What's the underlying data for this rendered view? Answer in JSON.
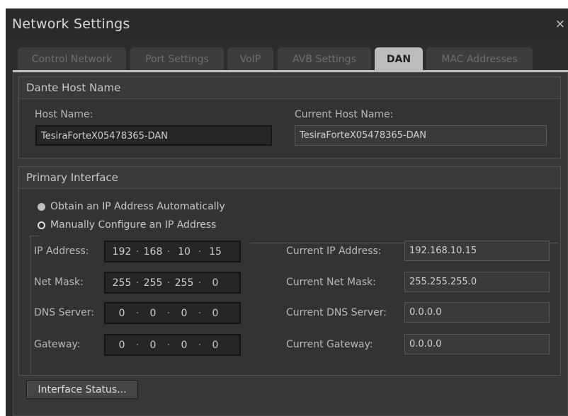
{
  "window": {
    "title": "Network Settings",
    "close_glyph": "×"
  },
  "tabs": [
    {
      "label": "Control Network",
      "active": false
    },
    {
      "label": "Port Settings",
      "active": false
    },
    {
      "label": "VoIP",
      "active": false
    },
    {
      "label": "AVB Settings",
      "active": false
    },
    {
      "label": "DAN",
      "active": true
    },
    {
      "label": "MAC Addresses",
      "active": false
    }
  ],
  "dante_host": {
    "header": "Dante Host Name",
    "host_name_label": "Host Name:",
    "host_name_value": "TesiraForteX05478365-DAN",
    "current_host_name_label": "Current Host Name:",
    "current_host_name_value": "TesiraForteX05478365-DAN"
  },
  "primary_interface": {
    "header": "Primary Interface",
    "radio_auto": "Obtain an IP Address Automatically",
    "radio_manual": "Manually Configure an IP Address",
    "selected": "manual",
    "ip_label": "IP Address:",
    "ip_octets": [
      "192",
      "168",
      "10",
      "15"
    ],
    "mask_label": "Net Mask:",
    "mask_octets": [
      "255",
      "255",
      "255",
      "0"
    ],
    "dns_label": "DNS Server:",
    "dns_octets": [
      "0",
      "0",
      "0",
      "0"
    ],
    "gateway_label": "Gateway:",
    "gateway_octets": [
      "0",
      "0",
      "0",
      "0"
    ],
    "current_ip_label": "Current IP Address:",
    "current_ip_value": "192.168.10.15",
    "current_mask_label": "Current Net Mask:",
    "current_mask_value": "255.255.255.0",
    "current_dns_label": "Current DNS Server:",
    "current_dns_value": "0.0.0.0",
    "current_gateway_label": "Current Gateway:",
    "current_gateway_value": "0.0.0.0"
  },
  "buttons": {
    "interface_status": "Interface Status..."
  },
  "colors": {
    "window_bg": "#2d2d2d",
    "active_tab": "#bdbdbd",
    "field_bg": "#262626"
  }
}
